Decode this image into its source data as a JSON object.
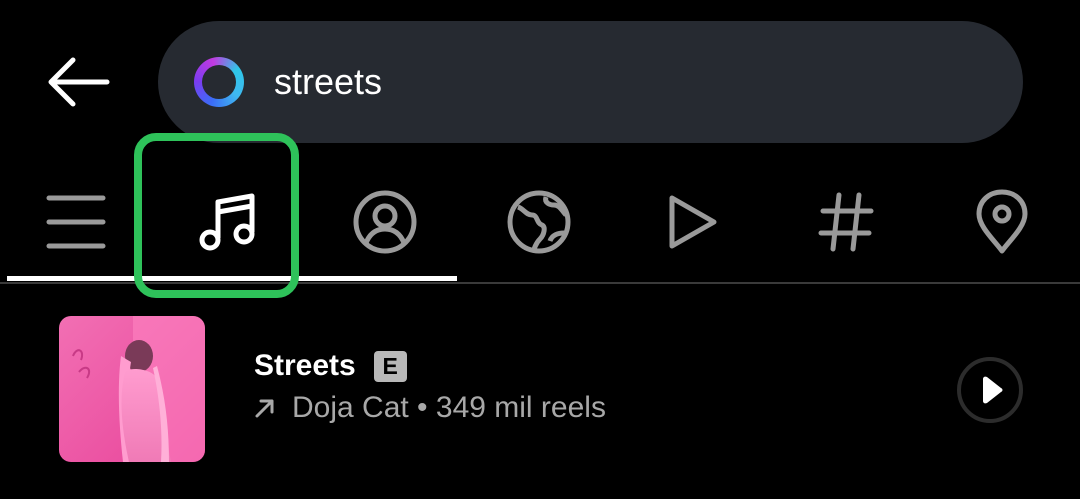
{
  "header": {
    "back_icon": "arrow-left-icon",
    "search": {
      "icon": "meta-ai-ring-icon",
      "value": "streets"
    }
  },
  "tabs": {
    "items": [
      {
        "icon": "menu-lines-icon",
        "name": "top"
      },
      {
        "icon": "music-note-icon",
        "name": "audio"
      },
      {
        "icon": "person-circle-icon",
        "name": "accounts"
      },
      {
        "icon": "globe-icon",
        "name": "explore"
      },
      {
        "icon": "play-icon",
        "name": "reels"
      },
      {
        "icon": "hashtag-icon",
        "name": "tags"
      },
      {
        "icon": "location-pin-icon",
        "name": "places"
      }
    ],
    "highlight_color": "#2ec25a"
  },
  "result": {
    "title": "Streets",
    "explicit_label": "E",
    "trend_icon": "arrow-up-right-icon",
    "meta": "Doja Cat • 349 mil reels",
    "play_icon": "play-icon",
    "album_colors": {
      "background": "#f05aa8",
      "accent": "#ff8cc8"
    }
  }
}
